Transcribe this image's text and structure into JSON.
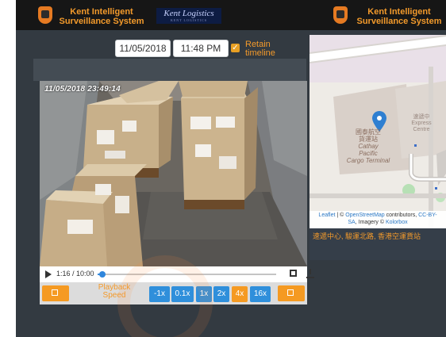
{
  "header": {
    "brand_line1": "Kent Intelligent",
    "brand_line2": "Surveillance System",
    "partner_logo": "Kent Logistics",
    "partner_logo_sub": "KENT LOGISTICS"
  },
  "controls": {
    "date": "11/05/2018",
    "time": "11:48 PM",
    "retain_label_1": "Retain",
    "retain_label_2": "timeline",
    "retain_checked": true
  },
  "video": {
    "timestamp": "11/05/2018 23:49:14",
    "progress_fraction": 0.027
  },
  "player": {
    "time_display": "1:16 / 10:00"
  },
  "speed": {
    "label_line1": "Playback",
    "label_line2": "Speed",
    "options": [
      "-1x",
      "0.1x",
      "1x",
      "2x",
      "4x",
      "16x"
    ],
    "selected": "4x"
  },
  "map": {
    "label_cn_1": "國泰航空",
    "label_cn_2": "貨運站",
    "label_en_1": "Cathay",
    "label_en_2": "Pacific",
    "label_en_3": "Cargo Terminal",
    "express_cn": "速遞中",
    "express_en_1": "Express",
    "express_en_2": "Centre",
    "attr_leaflet": "Leaflet",
    "attr_sep": " | © ",
    "attr_osm": "OpenStreetMap",
    "attr_contrib": " contributors, ",
    "attr_cc": "CC-BY-",
    "attr_sa": "SA",
    "attr_imagery": ", Imagery © ",
    "attr_kolorbox": "Kolorbox",
    "address": "速遞中心, 駿運北路, 香港空運貨站"
  },
  "colors": {
    "accent": "#f39a2b",
    "speed_button": "#2f8fdb",
    "speed_selected": "#f59a22",
    "pin": "#2f7fd1"
  },
  "icons": [
    "play-icon",
    "fullscreen-icon",
    "download-icon",
    "prev-icon",
    "next-icon",
    "map-pin-icon"
  ]
}
